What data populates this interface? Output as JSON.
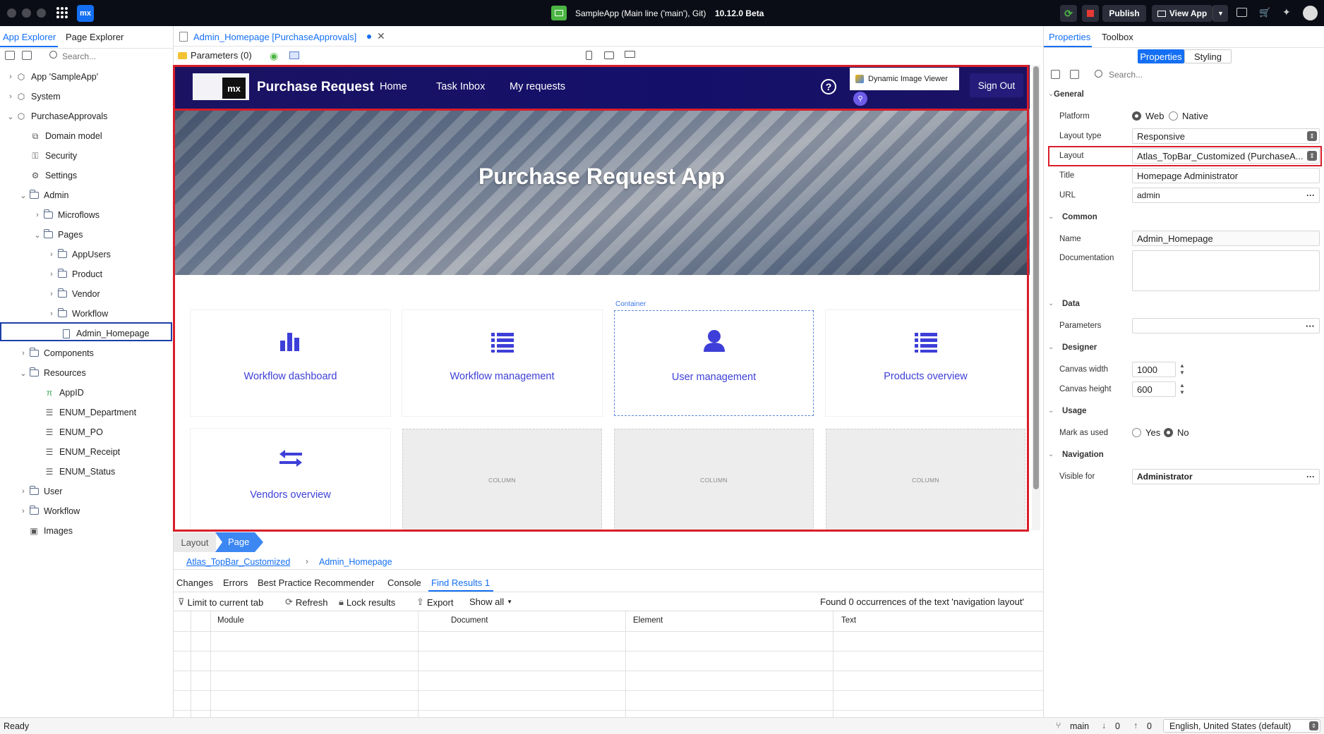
{
  "titlebar": {
    "mx_logo": "mx",
    "app_title": "SampleApp (Main line ('main'), Git)",
    "version": "10.12.0 Beta",
    "publish_label": "Publish",
    "view_app_label": "View App"
  },
  "left_panel": {
    "tabs": [
      "App Explorer",
      "Page Explorer"
    ],
    "search_placeholder": "Search...",
    "tree": [
      {
        "label": "App 'SampleApp'",
        "icon": "app-icon"
      },
      {
        "label": "System",
        "icon": "module-icon"
      },
      {
        "label": "PurchaseApprovals",
        "icon": "module-icon"
      },
      {
        "label": "Domain model",
        "icon": "domain-model-icon"
      },
      {
        "label": "Security",
        "icon": "key-icon"
      },
      {
        "label": "Settings",
        "icon": "gear-icon"
      },
      {
        "label": "Admin",
        "icon": "folder-icon"
      },
      {
        "label": "Microflows",
        "icon": "folder-icon"
      },
      {
        "label": "Pages",
        "icon": "folder-icon"
      },
      {
        "label": "AppUsers",
        "icon": "folder-icon"
      },
      {
        "label": "Product",
        "icon": "folder-icon"
      },
      {
        "label": "Vendor",
        "icon": "folder-icon"
      },
      {
        "label": "Workflow",
        "icon": "folder-icon"
      },
      {
        "label": "Admin_Homepage",
        "icon": "page-icon"
      },
      {
        "label": "Components",
        "icon": "folder-icon"
      },
      {
        "label": "Resources",
        "icon": "folder-icon"
      },
      {
        "label": "AppID",
        "icon": "constant-icon"
      },
      {
        "label": "ENUM_Department",
        "icon": "enumeration-icon"
      },
      {
        "label": "ENUM_PO",
        "icon": "enumeration-icon"
      },
      {
        "label": "ENUM_Receipt",
        "icon": "enumeration-icon"
      },
      {
        "label": "ENUM_Status",
        "icon": "enumeration-icon"
      },
      {
        "label": "User",
        "icon": "folder-icon"
      },
      {
        "label": "Workflow",
        "icon": "folder-icon"
      },
      {
        "label": "Images",
        "icon": "images-icon"
      }
    ]
  },
  "editor": {
    "doc_tab": "Admin_Homepage [PurchaseApprovals]",
    "parameters_label": "Parameters (0)",
    "page": {
      "logo_text": "mx",
      "brand": "Purchase Request",
      "nav": [
        "Home",
        "Task Inbox",
        "My requests"
      ],
      "widget_label": "Dynamic Image Viewer",
      "sign_out": "Sign Out",
      "hero_title": "Purchase Request App",
      "container_label": "Container",
      "cards": [
        {
          "label": "Workflow dashboard",
          "icon": "bar-chart-icon"
        },
        {
          "label": "Workflow management",
          "icon": "list-icon"
        },
        {
          "label": "User management",
          "icon": "user-icon"
        },
        {
          "label": "Products overview",
          "icon": "list-icon"
        },
        {
          "label": "Vendors overview",
          "icon": "exchange-icon"
        }
      ],
      "column_placeholder": "COLUMN"
    },
    "breadcrumb_tabs": [
      "Layout",
      "Page"
    ],
    "breadcrumb_links": [
      "Atlas_TopBar_Customized",
      "Admin_Homepage"
    ]
  },
  "bottom_panel": {
    "tabs": [
      "Changes",
      "Errors",
      "Best Practice Recommender",
      "Console",
      "Find Results 1"
    ],
    "toolbar": {
      "limit": "Limit to current tab",
      "refresh": "Refresh",
      "lock": "Lock results",
      "export": "Export",
      "show_all": "Show all"
    },
    "result_text": "Found 0 occurrences of the text 'navigation layout'",
    "columns": [
      "Module",
      "Document",
      "Element",
      "Text"
    ]
  },
  "right_panel": {
    "tabs": [
      "Properties",
      "Toolbox"
    ],
    "subtabs": [
      "Properties",
      "Styling"
    ],
    "search_placeholder": "Search...",
    "sections": {
      "general": "General",
      "common": "Common",
      "data": "Data",
      "designer": "Designer",
      "usage": "Usage",
      "navigation": "Navigation"
    },
    "labels": {
      "platform": "Platform",
      "layout_type": "Layout type",
      "layout": "Layout",
      "title": "Title",
      "url": "URL",
      "name": "Name",
      "documentation": "Documentation",
      "parameters": "Parameters",
      "canvas_width": "Canvas width",
      "canvas_height": "Canvas height",
      "mark_as_used": "Mark as used",
      "visible_for": "Visible for"
    },
    "values": {
      "platform_web": "Web",
      "platform_native": "Native",
      "layout_type": "Responsive",
      "layout": "Atlas_TopBar_Customized (PurchaseA...",
      "title": "Homepage Administrator",
      "url": "admin",
      "name": "Admin_Homepage",
      "canvas_width": "1000",
      "canvas_height": "600",
      "yes": "Yes",
      "no": "No",
      "visible_for": "Administrator"
    }
  },
  "status_bar": {
    "status": "Ready",
    "branch": "main",
    "down_count": "0",
    "up_count": "0",
    "language": "English, United States (default)"
  },
  "colors": {
    "accent": "#146ff4",
    "highlight_red": "#d91e2a",
    "page_navy": "#1b1362",
    "card_link": "#3d3fd8"
  }
}
